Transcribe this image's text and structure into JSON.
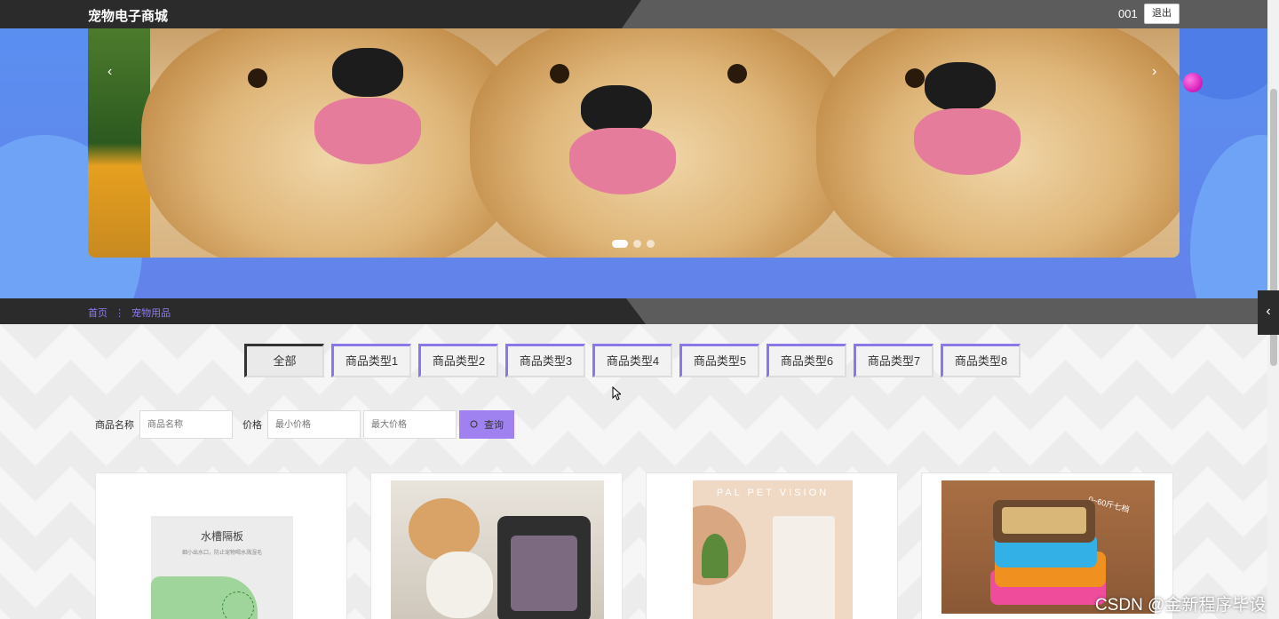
{
  "header": {
    "site_title": "宠物电子商城",
    "user_name": "001",
    "logout_label": "退出"
  },
  "banner": {
    "prev_icon": "‹",
    "next_icon": "›",
    "slides": 3,
    "active_slide": 1
  },
  "breadcrumb": {
    "home": "首页",
    "separator": "⋮",
    "current": "宠物用品"
  },
  "categories": [
    "全部",
    "商品类型1",
    "商品类型2",
    "商品类型3",
    "商品类型4",
    "商品类型5",
    "商品类型6",
    "商品类型7",
    "商品类型8"
  ],
  "filters": {
    "name_label": "商品名称",
    "name_placeholder": "商品名称",
    "price_label": "价格",
    "min_placeholder": "最小价格",
    "max_placeholder": "最大价格",
    "search_label": "查询"
  },
  "products": [
    {
      "image_text_title": "水槽隔板",
      "image_text_sub": "细小出水口，防止宠物喝水溅湿毛"
    },
    {
      "image_text_title": ""
    },
    {
      "image_text_title": "PAL PET VISION"
    },
    {
      "image_text_title": "0~60斤七档"
    }
  ],
  "watermark": "CSDN @金新程序毕设",
  "side_toggle_icon": "‹"
}
